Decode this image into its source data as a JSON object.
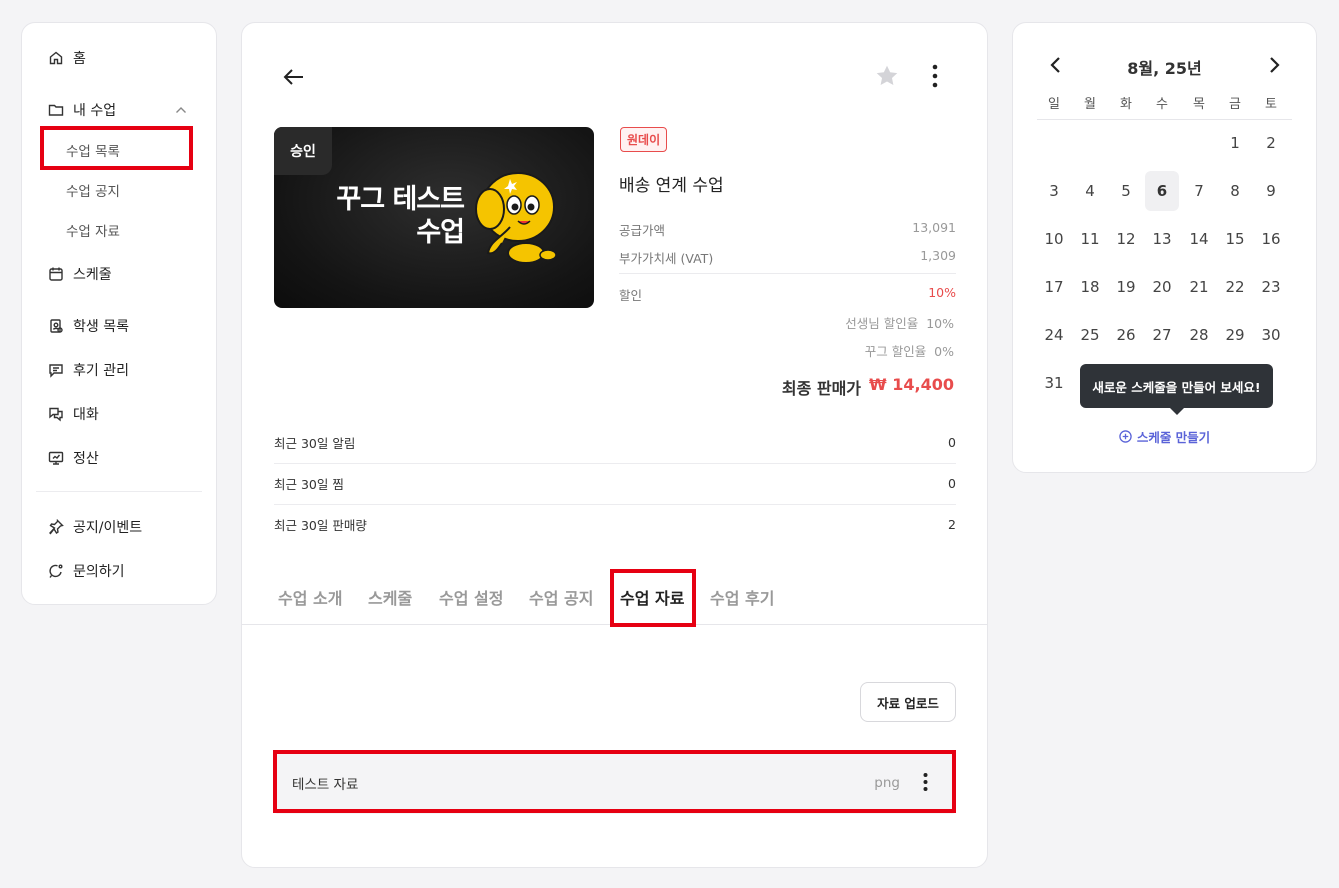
{
  "sidebar": {
    "home": "홈",
    "my_classes": "내 수업",
    "sub": {
      "list": "수업 목록",
      "notice": "수업 공지",
      "materials": "수업 자료"
    },
    "schedule": "스케줄",
    "students": "학생 목록",
    "reviews": "후기 관리",
    "chat": "대화",
    "settlement": "정산",
    "notice_event": "공지/이벤트",
    "inquiry": "문의하기"
  },
  "course": {
    "thumb_badge": "승인",
    "thumb_title": "꾸그 테스트\n수업",
    "tag": "원데이",
    "title": "배송 연계 수업",
    "supply_label": "공급가액",
    "supply_value": "13,091",
    "vat_label": "부가가치세 (VAT)",
    "vat_value": "1,309",
    "discount_label": "할인",
    "discount_value": "10%",
    "teacher_discount": "선생님 할인율  10%",
    "ggug_discount": "꾸그 할인율  0%",
    "final_label": "최종 판매가",
    "final_value": "₩ 14,400"
  },
  "stats": [
    {
      "label": "최근 30일 알림",
      "value": "0"
    },
    {
      "label": "최근 30일 찜",
      "value": "0"
    },
    {
      "label": "최근 30일 판매량",
      "value": "2"
    }
  ],
  "tabs": [
    "수업 소개",
    "스케줄",
    "수업 설정",
    "수업 공지",
    "수업 자료",
    "수업 후기"
  ],
  "materials": {
    "upload_label": "자료 업로드",
    "files": [
      {
        "name": "테스트 자료",
        "ext": "png"
      }
    ]
  },
  "calendar": {
    "title": "8월, 25년",
    "dow": [
      "일",
      "월",
      "화",
      "수",
      "목",
      "금",
      "토"
    ],
    "today": "6",
    "tooltip": "새로운 스케줄을 만들어 보세요!",
    "make_label": "스케줄 만들기"
  },
  "colors": {
    "accent": "#5a63d8",
    "discount": "#e84c4c",
    "highlight": "#e60012"
  }
}
